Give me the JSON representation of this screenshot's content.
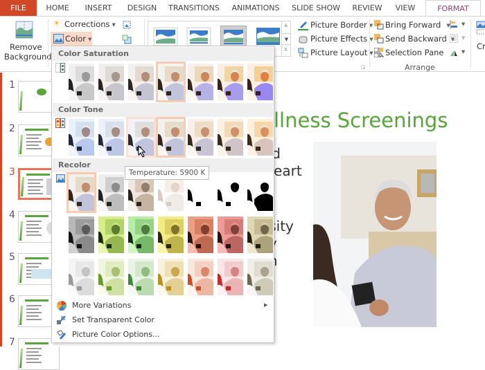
{
  "ribbon_tabs": [
    {
      "label": "FILE",
      "active": false
    },
    {
      "label": "HOME",
      "active": false
    },
    {
      "label": "INSERT",
      "active": false
    },
    {
      "label": "DESIGN",
      "active": false
    },
    {
      "label": "TRANSITIONS",
      "active": false
    },
    {
      "label": "ANIMATIONS",
      "active": false
    },
    {
      "label": "SLIDE SHOW",
      "active": false
    },
    {
      "label": "REVIEW",
      "active": false
    },
    {
      "label": "VIEW",
      "active": false
    },
    {
      "label": "FORMAT",
      "active": true
    }
  ],
  "ribbon": {
    "remove_background": "Remove Background",
    "remove_background_l1": "Remove",
    "remove_background_l2": "Background",
    "corrections": "Corrections",
    "color": "Color",
    "picture_border": "Picture Border",
    "picture_effects": "Picture Effects",
    "picture_layout": "Picture Layout",
    "bring_forward": "Bring Forward",
    "send_backward": "Send Backward",
    "selection_pane": "Selection Pane",
    "arrange_group": "Arrange",
    "crop_partial": "Cr"
  },
  "dropdown": {
    "sections": [
      {
        "title": "Color Saturation",
        "selected_index": 3
      },
      {
        "title": "Color Tone",
        "selected_index": 3,
        "hovered_index": 2
      },
      {
        "title": "Recolor",
        "selected_index": 0
      }
    ],
    "tooltip": "Temperature: 5900 K",
    "menu": [
      {
        "label": "More Variations",
        "has_submenu": true,
        "icon": "palette-icon"
      },
      {
        "label": "Set Transparent Color",
        "has_submenu": false,
        "icon": "transparent-color-icon"
      },
      {
        "label": "Picture Color Options...",
        "has_submenu": false,
        "icon": "picture-color-options-icon"
      }
    ]
  },
  "slides": {
    "count_visible": 7,
    "selected": 3,
    "numbers": [
      "1",
      "2",
      "3",
      "4",
      "5",
      "6",
      "7"
    ]
  },
  "slide": {
    "title_visible": "llness Screenings",
    "body_fragments": [
      "od",
      "Heart",
      ",",
      "e",
      "rsity",
      "ty",
      "th",
      "s"
    ]
  },
  "colors": {
    "file_tab": "#d24726",
    "format_tab": "#a5386e",
    "title_green": "#58a53a",
    "selection": "#f8cbb5"
  }
}
